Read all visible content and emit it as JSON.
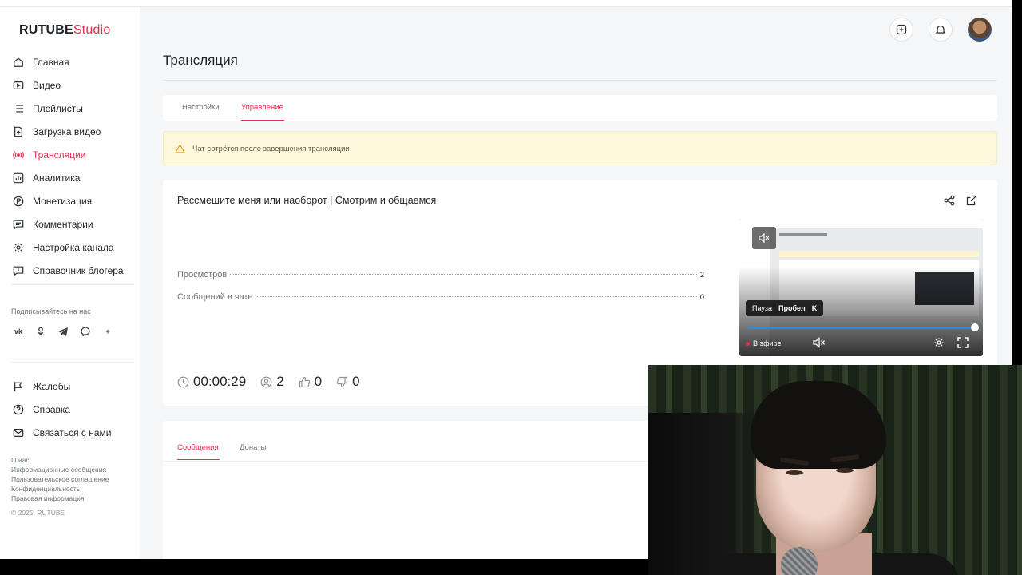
{
  "app": {
    "logo_main": "RUTUBE",
    "logo_studio": "Studio"
  },
  "sidebar": {
    "items": [
      {
        "label": "Главная",
        "icon": "home-icon"
      },
      {
        "label": "Видео",
        "icon": "video-icon"
      },
      {
        "label": "Плейлисты",
        "icon": "playlist-icon"
      },
      {
        "label": "Загрузка видео",
        "icon": "upload-icon"
      },
      {
        "label": "Трансляции",
        "icon": "broadcast-icon",
        "active": true
      },
      {
        "label": "Аналитика",
        "icon": "analytics-icon"
      },
      {
        "label": "Монетизация",
        "icon": "monetization-icon"
      },
      {
        "label": "Комментарии",
        "icon": "comments-icon"
      },
      {
        "label": "Настройка канала",
        "icon": "settings-icon"
      },
      {
        "label": "Справочник блогера",
        "icon": "guide-icon"
      }
    ],
    "follow_label": "Подписывайтесь на нас",
    "socials": [
      "vk-icon",
      "ok-icon",
      "telegram-icon",
      "viber-icon",
      "plus-icon"
    ],
    "secondary": [
      {
        "label": "Жалобы",
        "icon": "flag-icon"
      },
      {
        "label": "Справка",
        "icon": "help-icon"
      },
      {
        "label": "Связаться с нами",
        "icon": "mail-icon"
      }
    ],
    "footer_links": [
      "О нас",
      "Информационные сообщения",
      "Пользовательское соглашение",
      "Конфиденциальность",
      "Правовая информация"
    ],
    "copyright": "© 2025, RUTUBE"
  },
  "header": {
    "title": "Трансляция"
  },
  "tabs": [
    {
      "label": "Настройки"
    },
    {
      "label": "Управление",
      "active": true
    }
  ],
  "alert": {
    "text": "Чат сотрётся после завершения трансляции"
  },
  "stream": {
    "title": "Рассмешите меня или наоборот | Смотрим и общаемся",
    "stats": [
      {
        "label": "Просмотров",
        "value": "2"
      },
      {
        "label": "Сообщений в чате",
        "value": "0"
      }
    ],
    "metrics": {
      "duration": "00:00:29",
      "viewers": "2",
      "likes": "0",
      "dislikes": "0"
    }
  },
  "player": {
    "tooltip_action": "Пауза",
    "tooltip_key1": "Пробел",
    "tooltip_key2": "K",
    "live_label": "В эфире",
    "progress": 1.0
  },
  "chat": {
    "tabs": [
      {
        "label": "Сообщения",
        "active": true
      },
      {
        "label": "Донаты"
      }
    ]
  },
  "colors": {
    "accent": "#e5304d",
    "alert_bg": "#fdf7dc",
    "progress": "#2f8bd8"
  }
}
